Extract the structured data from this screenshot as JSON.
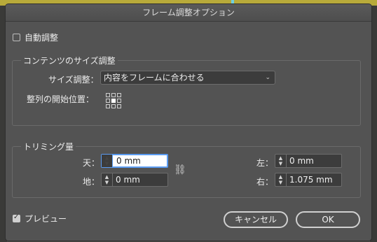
{
  "dialog": {
    "title": "フレーム調整オプション"
  },
  "auto_fit": {
    "label": "自動調整",
    "checked": false
  },
  "content_size": {
    "group_title": "コンテンツのサイズ調整",
    "size_label": "サイズ調整：",
    "size_value": "内容をフレームに合わせる",
    "align_label": "整列の開始位置："
  },
  "trim": {
    "group_title": "トリミング量",
    "top_label": "天：",
    "top_value": "0 mm",
    "bottom_label": "地：",
    "bottom_value": "0 mm",
    "left_label": "左：",
    "left_value": "0 mm",
    "right_label": "右：",
    "right_value": "1.075 mm"
  },
  "preview": {
    "label": "プレビュー",
    "checked": true
  },
  "buttons": {
    "cancel": "キャンセル",
    "ok": "OK"
  }
}
